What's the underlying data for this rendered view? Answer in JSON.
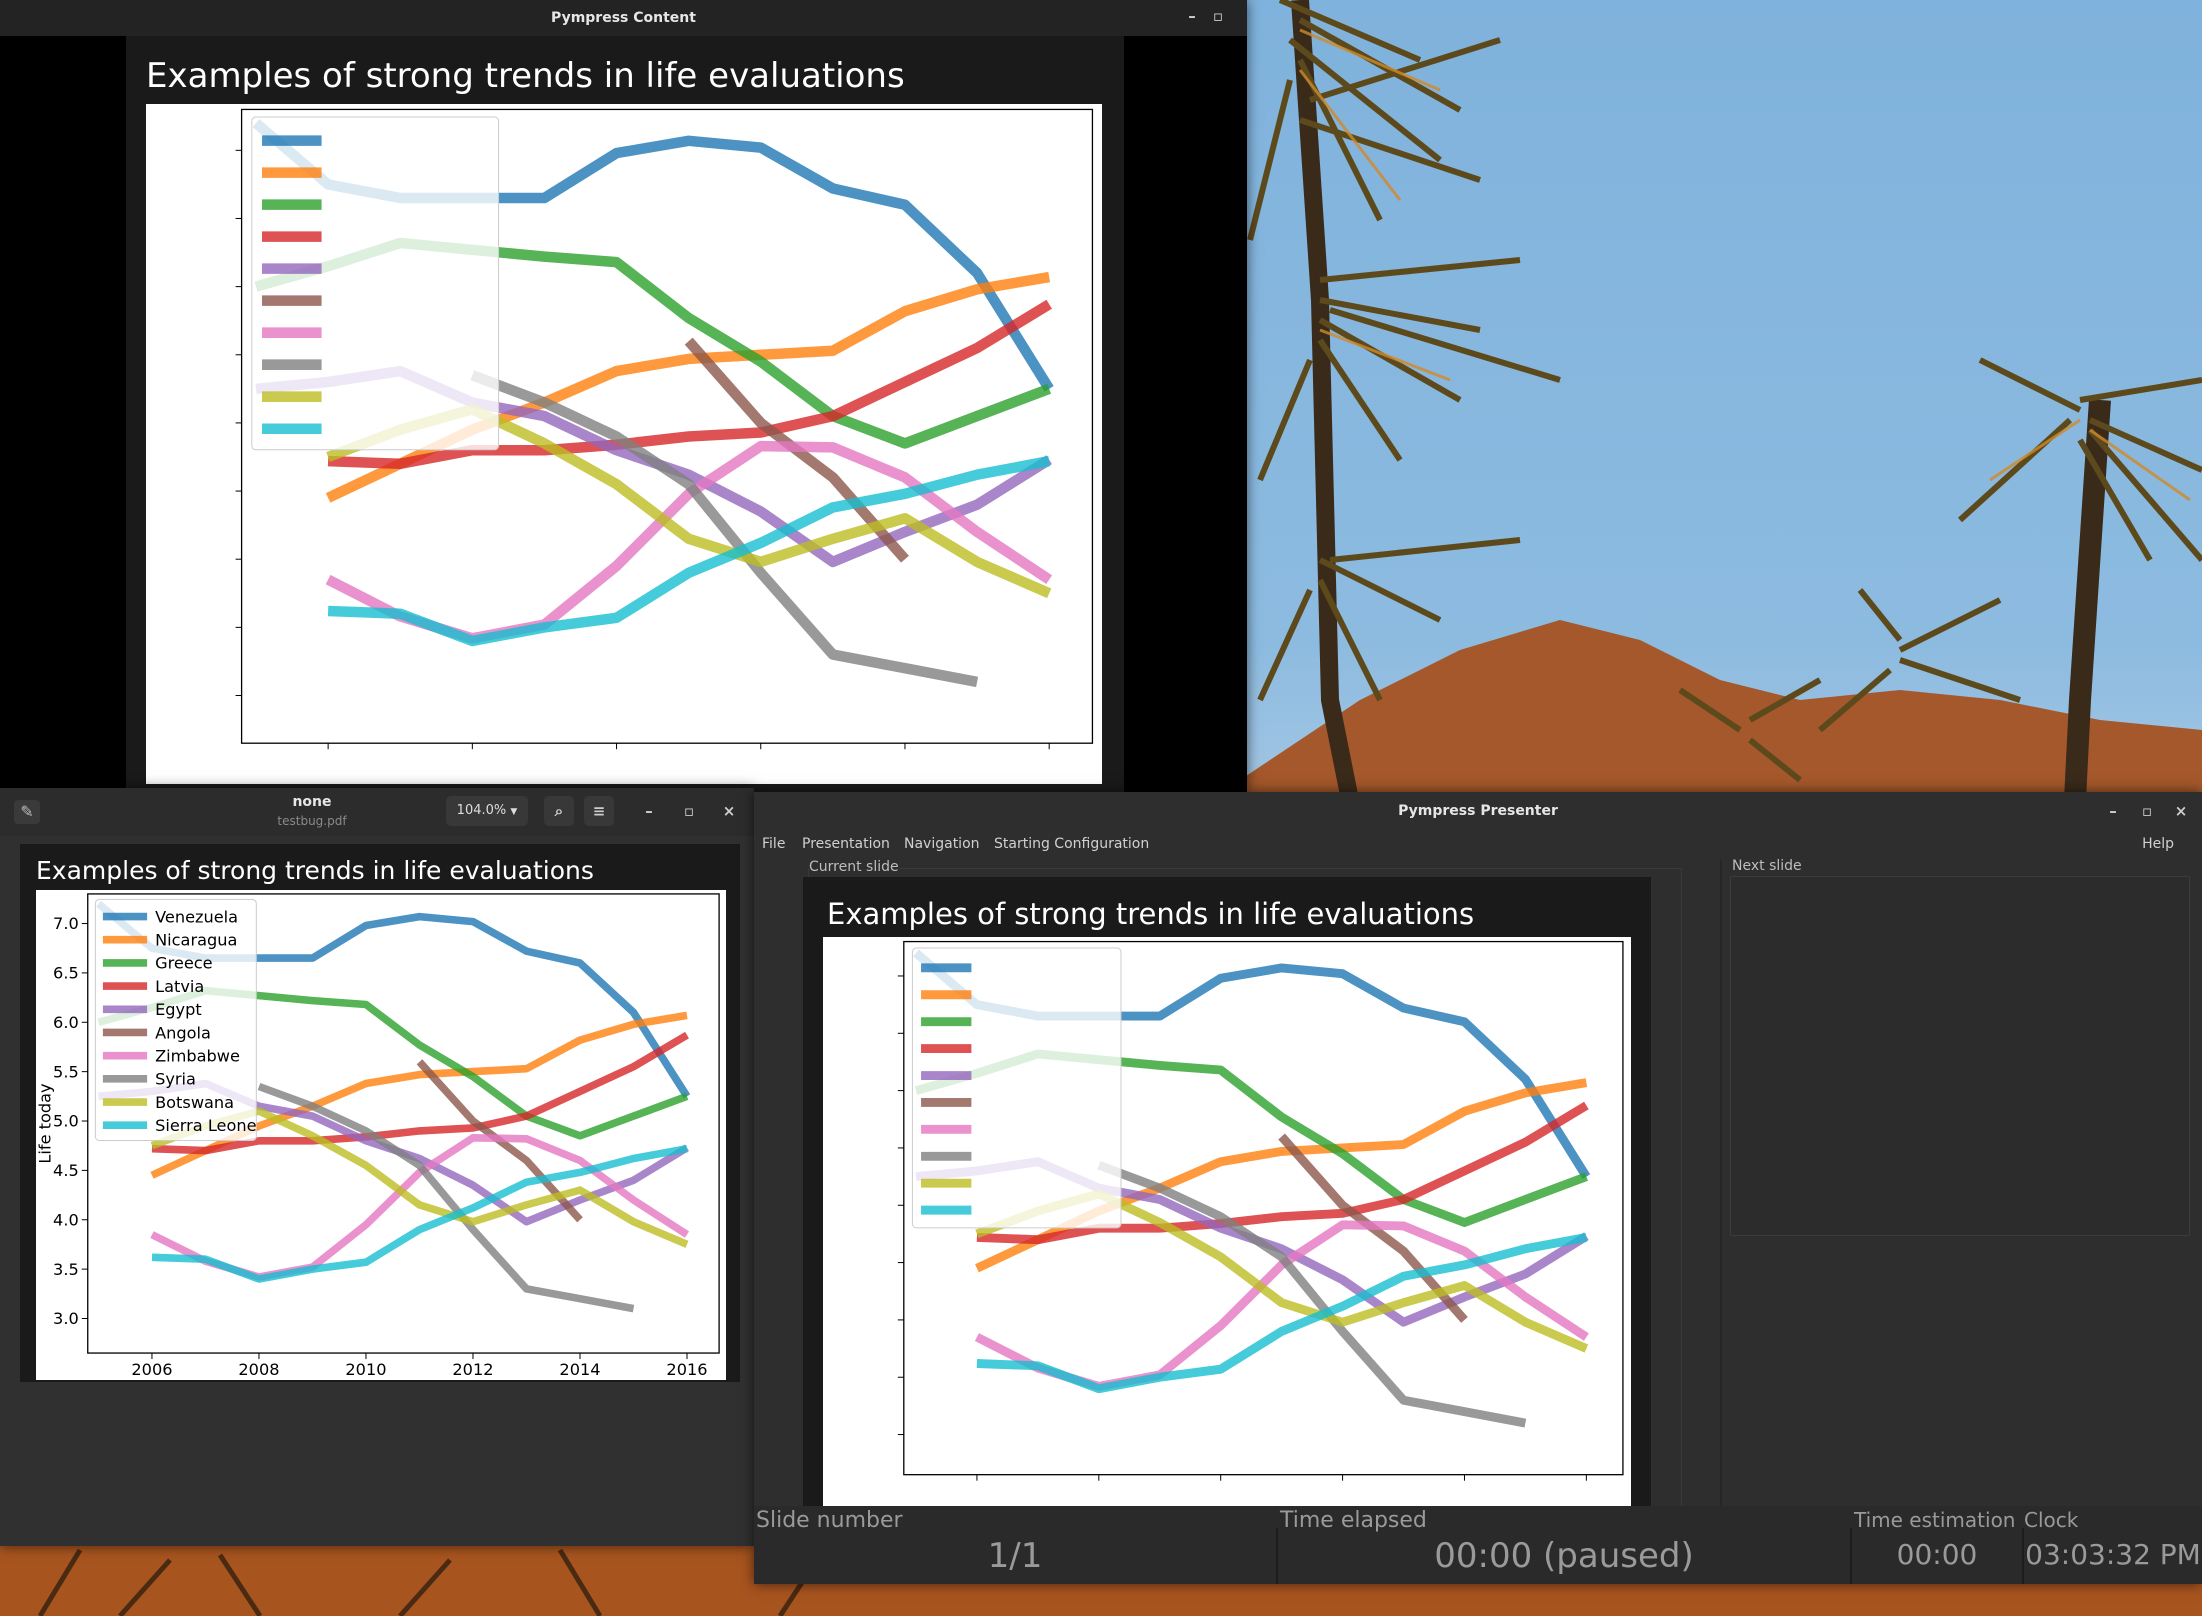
{
  "slide_title": "Examples of strong trends in life evaluations",
  "content_window": {
    "title": "Pympress Content"
  },
  "viewer_window": {
    "title": "none",
    "subtitle": "testbug.pdf",
    "zoom": "104.0%"
  },
  "presenter_window": {
    "title": "Pympress Presenter",
    "menu": [
      "File",
      "Presentation",
      "Navigation",
      "Starting Configuration"
    ],
    "help": "Help",
    "current_label": "Current slide",
    "next_label": "Next slide",
    "slide_number_label": "Slide number",
    "slide_number": "1/1",
    "time_elapsed_label": "Time elapsed",
    "time_elapsed": "00:00 (paused)",
    "time_estimation_label": "Time estimation",
    "time_estimation": "00:00",
    "clock_label": "Clock",
    "clock": "03:03:32 PM"
  },
  "chart_data": {
    "type": "line",
    "title": "Examples of strong trends in life evaluations",
    "ylabel": "Life today",
    "xlabel": "",
    "xlim": [
      2004.8,
      2016.6
    ],
    "ylim": [
      2.65,
      7.3
    ],
    "xticks": [
      2006,
      2008,
      2010,
      2012,
      2014,
      2016
    ],
    "yticks": [
      3.0,
      3.5,
      4.0,
      4.5,
      5.0,
      5.5,
      6.0,
      6.5,
      7.0
    ],
    "legend": "upper-left",
    "series": [
      {
        "name": "Venezuela",
        "color": "#1f77b4",
        "x": [
          2005,
          2006,
          2007,
          2008,
          2009,
          2010,
          2011,
          2012,
          2013,
          2014,
          2015,
          2016
        ],
        "y": [
          7.2,
          6.75,
          6.65,
          6.65,
          6.65,
          6.98,
          7.07,
          7.02,
          6.72,
          6.6,
          6.1,
          5.25
        ]
      },
      {
        "name": "Nicaragua",
        "color": "#ff7f0e",
        "x": [
          2006,
          2007,
          2008,
          2009,
          2010,
          2011,
          2012,
          2013,
          2014,
          2015,
          2016
        ],
        "y": [
          4.45,
          4.7,
          4.95,
          5.15,
          5.38,
          5.47,
          5.5,
          5.53,
          5.82,
          5.98,
          6.07
        ]
      },
      {
        "name": "Greece",
        "color": "#2ca02c",
        "x": [
          2005,
          2006,
          2007,
          2008,
          2009,
          2010,
          2011,
          2012,
          2013,
          2014,
          2015,
          2016
        ],
        "y": [
          6.0,
          6.15,
          6.32,
          6.27,
          6.22,
          6.18,
          5.77,
          5.45,
          5.05,
          4.85,
          5.05,
          5.25
        ]
      },
      {
        "name": "Latvia",
        "color": "#d62728",
        "x": [
          2006,
          2007,
          2008,
          2009,
          2010,
          2011,
          2012,
          2013,
          2014,
          2015,
          2016
        ],
        "y": [
          4.72,
          4.7,
          4.8,
          4.8,
          4.84,
          4.9,
          4.93,
          5.05,
          5.3,
          5.55,
          5.87
        ]
      },
      {
        "name": "Egypt",
        "color": "#9467bd",
        "x": [
          2005,
          2006,
          2007,
          2008,
          2009,
          2010,
          2011,
          2012,
          2013,
          2014,
          2015,
          2016
        ],
        "y": [
          5.25,
          5.3,
          5.38,
          5.15,
          5.05,
          4.8,
          4.62,
          4.35,
          3.98,
          4.2,
          4.4,
          4.73
        ]
      },
      {
        "name": "Angola",
        "color": "#8c564b",
        "x": [
          2011,
          2012,
          2013,
          2014
        ],
        "y": [
          5.6,
          5.0,
          4.6,
          4.0
        ]
      },
      {
        "name": "Zimbabwe",
        "color": "#e377c2",
        "x": [
          2006,
          2007,
          2008,
          2009,
          2010,
          2011,
          2012,
          2013,
          2014,
          2015,
          2016
        ],
        "y": [
          3.85,
          3.58,
          3.42,
          3.52,
          3.95,
          4.48,
          4.83,
          4.82,
          4.6,
          4.2,
          3.85
        ]
      },
      {
        "name": "Syria",
        "color": "#7f7f7f",
        "x": [
          2008,
          2009,
          2010,
          2011,
          2012,
          2013,
          2014,
          2015
        ],
        "y": [
          5.35,
          5.15,
          4.9,
          4.55,
          3.9,
          3.3,
          3.2,
          3.1
        ]
      },
      {
        "name": "Botswana",
        "color": "#bcbd22",
        "x": [
          2006,
          2007,
          2008,
          2009,
          2010,
          2011,
          2012,
          2013,
          2014,
          2015,
          2016
        ],
        "y": [
          4.75,
          4.95,
          5.1,
          4.85,
          4.55,
          4.15,
          3.98,
          4.15,
          4.3,
          3.98,
          3.75
        ]
      },
      {
        "name": "Sierra Leone",
        "color": "#17becf",
        "x": [
          2006,
          2007,
          2008,
          2009,
          2010,
          2011,
          2012,
          2013,
          2014,
          2015,
          2016
        ],
        "y": [
          3.62,
          3.6,
          3.4,
          3.5,
          3.57,
          3.9,
          4.12,
          4.38,
          4.48,
          4.62,
          4.72
        ]
      }
    ]
  }
}
